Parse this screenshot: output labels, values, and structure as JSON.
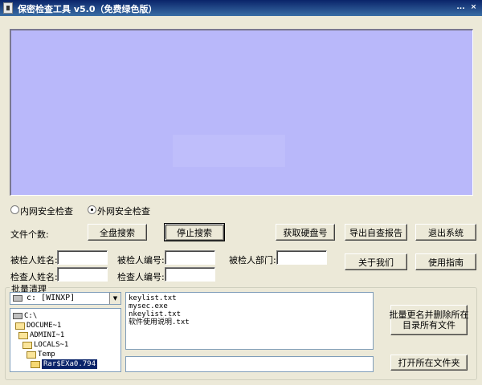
{
  "window": {
    "title": "保密检查工具 v5.0（免费绿色版）",
    "controls": {
      "minimize": "...",
      "close": "×"
    }
  },
  "mode": {
    "intranet_label": "内网安全检查",
    "internet_label": "外网安全检查",
    "selected": "internet"
  },
  "labels": {
    "file_count": "文件个数:",
    "inspectee_name": "被检人姓名:",
    "inspectee_id": "被检人编号:",
    "inspectee_dept": "被检人部门:",
    "inspector_name": "检查人姓名:",
    "inspector_id": "检查人编号:",
    "batch_clean": "批量清理"
  },
  "buttons": {
    "full_search": "全盘搜索",
    "stop_search": "停止搜索",
    "get_disk_id": "获取硬盘号",
    "export_report": "导出自查报告",
    "exit": "退出系统",
    "about": "关于我们",
    "guide": "使用指南",
    "rename_delete_line1": "批量更名并删除所在",
    "rename_delete_line2": "目录所有文件",
    "open_folder": "打开所在文件夹"
  },
  "fields": {
    "inspectee_name": "",
    "inspectee_id": "",
    "inspectee_dept": "",
    "inspector_name": "",
    "inspector_id": "",
    "path": ""
  },
  "drive": {
    "selected": "c: [WINXP]"
  },
  "tree": [
    {
      "label": "C:\\",
      "type": "drive",
      "level": 0
    },
    {
      "label": "DOCUME~1",
      "type": "folder",
      "level": 1
    },
    {
      "label": "ADMINI~1",
      "type": "folder",
      "level": 2
    },
    {
      "label": "LOCALS~1",
      "type": "folder",
      "level": 3
    },
    {
      "label": "Temp",
      "type": "folder",
      "level": 4
    },
    {
      "label": "Rar$EXa0.794",
      "type": "folder",
      "level": 5,
      "selected": true
    }
  ],
  "files": [
    "keylist.txt",
    "mysec.exe",
    "nkeylist.txt",
    "软件使用说明.txt"
  ],
  "colors": {
    "window_bg": "#ece9d8",
    "title_bar_start": "#0a246a",
    "title_bar_end": "#3a6ea5",
    "result_panel": "#b9b8fa"
  }
}
